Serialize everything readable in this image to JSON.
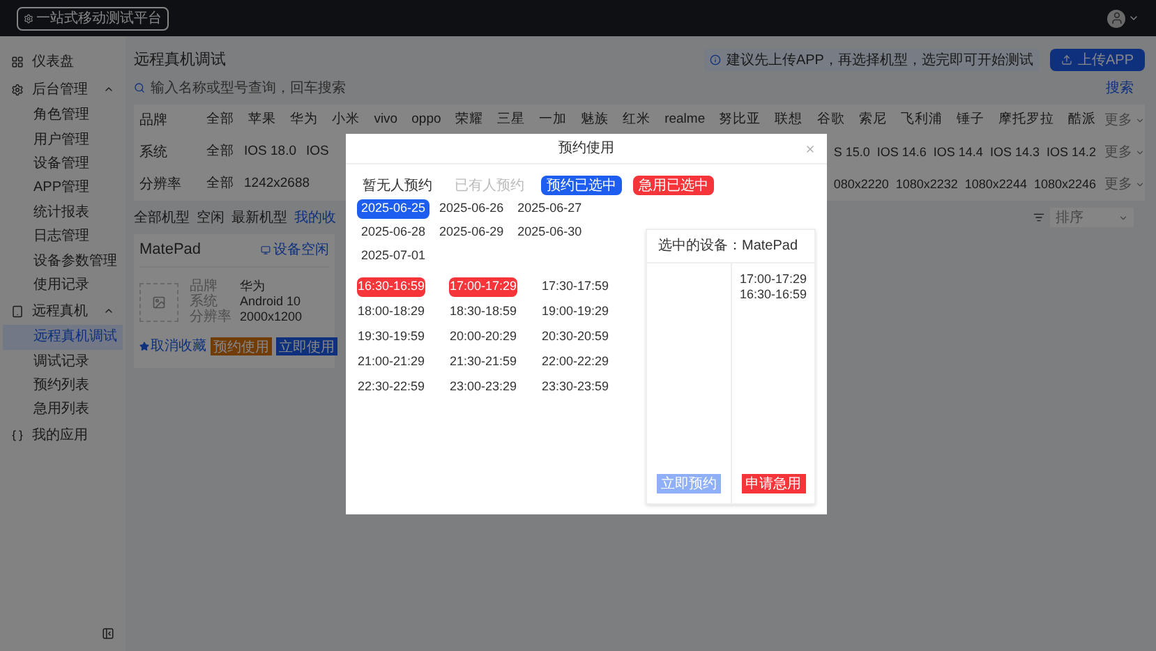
{
  "topbar": {
    "logo": "一站式移动测试平台"
  },
  "sidebar": {
    "items": [
      {
        "label": "仪表盘",
        "selected": false
      },
      {
        "label": "后台管理",
        "selected": false,
        "expanded": true,
        "children": [
          {
            "label": "角色管理",
            "selected": false
          },
          {
            "label": "用户管理",
            "selected": false
          },
          {
            "label": "设备管理",
            "selected": false
          },
          {
            "label": "APP管理",
            "selected": false
          },
          {
            "label": "统计报表",
            "selected": false
          },
          {
            "label": "日志管理",
            "selected": false
          },
          {
            "label": "设备参数管理",
            "selected": false
          },
          {
            "label": "使用记录",
            "selected": false
          }
        ]
      },
      {
        "label": "远程真机",
        "selected": false,
        "expanded": true,
        "children": [
          {
            "label": "远程真机调试",
            "selected": true
          },
          {
            "label": "调试记录",
            "selected": false
          },
          {
            "label": "预约列表",
            "selected": false
          },
          {
            "label": "急用列表",
            "selected": false
          }
        ]
      },
      {
        "label": "我的应用",
        "selected": false
      }
    ]
  },
  "page": {
    "title": "远程真机调试",
    "notice": "建议先上传APP，再选择机型，选完即可开始测试",
    "upload_button": "上传APP",
    "search": {
      "placeholder": "输入名称或型号查询，回车搜索"
    },
    "search_link": "搜索"
  },
  "filters": [
    {
      "label": "品牌",
      "options_left": [
        "全部",
        "苹果",
        "华为",
        "小米",
        "vivo",
        "oppo",
        "荣耀",
        "三星",
        "一加",
        "魅族",
        "红米",
        "realme",
        "努比亚",
        "联想",
        "谷歌",
        "索尼",
        "飞利浦",
        "锤子",
        "摩托罗拉",
        "酷派"
      ],
      "more": "更多"
    },
    {
      "label": "系统",
      "options_left": [
        "全部",
        "IOS 18.0",
        "IOS"
      ],
      "options_right": [
        "S 15.0",
        "IOS 14.6",
        "IOS 14.4",
        "IOS 14.3",
        "IOS 14.2"
      ],
      "more": "更多"
    },
    {
      "label": "分辨率",
      "options_left": [
        "全部",
        "1242x2688"
      ],
      "options_right": [
        "080x2220",
        "1080x2232",
        "1080x2244",
        "1080x2246"
      ],
      "more": "更多"
    }
  ],
  "tabs": [
    {
      "label": "全部机型",
      "selected": false
    },
    {
      "label": "空闲",
      "selected": false
    },
    {
      "label": "最新机型",
      "selected": false
    },
    {
      "label": "我的收",
      "selected": true
    }
  ],
  "sort": {
    "placeholder": "排序"
  },
  "device_card": {
    "name": "MatePad",
    "status": "设备空闲",
    "specs": [
      {
        "label": "品牌",
        "value": "华为"
      },
      {
        "label": "系统",
        "value": "Android 10"
      },
      {
        "label": "分辨率",
        "value": "2000x1200"
      }
    ],
    "favorite": "取消收藏",
    "reserve_button": "预约使用",
    "use_button": "立即使用"
  },
  "dialog": {
    "title": "预约使用",
    "legend": [
      {
        "label": "暂无人预约",
        "kind": "free"
      },
      {
        "label": "已有人预约",
        "kind": "booked"
      },
      {
        "label": "预约已选中",
        "kind": "reserved"
      },
      {
        "label": "急用已选中",
        "kind": "urgent"
      }
    ],
    "dates": [
      {
        "label": "2025-06-25",
        "selected": true
      },
      {
        "label": "2025-06-26",
        "selected": false
      },
      {
        "label": "2025-06-27",
        "selected": false
      },
      {
        "label": "2025-06-28",
        "selected": false
      },
      {
        "label": "2025-06-29",
        "selected": false
      },
      {
        "label": "2025-06-30",
        "selected": false
      },
      {
        "label": "2025-07-01",
        "selected": false
      }
    ],
    "slots": [
      {
        "label": "16:30-16:59",
        "kind": "urgent"
      },
      {
        "label": "17:00-17:29",
        "kind": "urgent"
      },
      {
        "label": "17:30-17:59",
        "kind": "free"
      },
      {
        "label": "18:00-18:29",
        "kind": "free"
      },
      {
        "label": "18:30-18:59",
        "kind": "free"
      },
      {
        "label": "19:00-19:29",
        "kind": "free"
      },
      {
        "label": "19:30-19:59",
        "kind": "free"
      },
      {
        "label": "20:00-20:29",
        "kind": "free"
      },
      {
        "label": "20:30-20:59",
        "kind": "free"
      },
      {
        "label": "21:00-21:29",
        "kind": "free"
      },
      {
        "label": "21:30-21:59",
        "kind": "free"
      },
      {
        "label": "22:00-22:29",
        "kind": "free"
      },
      {
        "label": "22:30-22:59",
        "kind": "free"
      },
      {
        "label": "23:00-23:29",
        "kind": "free"
      },
      {
        "label": "23:30-23:59",
        "kind": "free"
      }
    ],
    "panel": {
      "title": "选中的设备：MatePad",
      "urgent": [
        "17:00-17:29",
        "16:30-16:59"
      ],
      "reserve_button": {
        "label": "立即预约",
        "disabled": true
      },
      "urgent_button": "申请急用"
    }
  }
}
